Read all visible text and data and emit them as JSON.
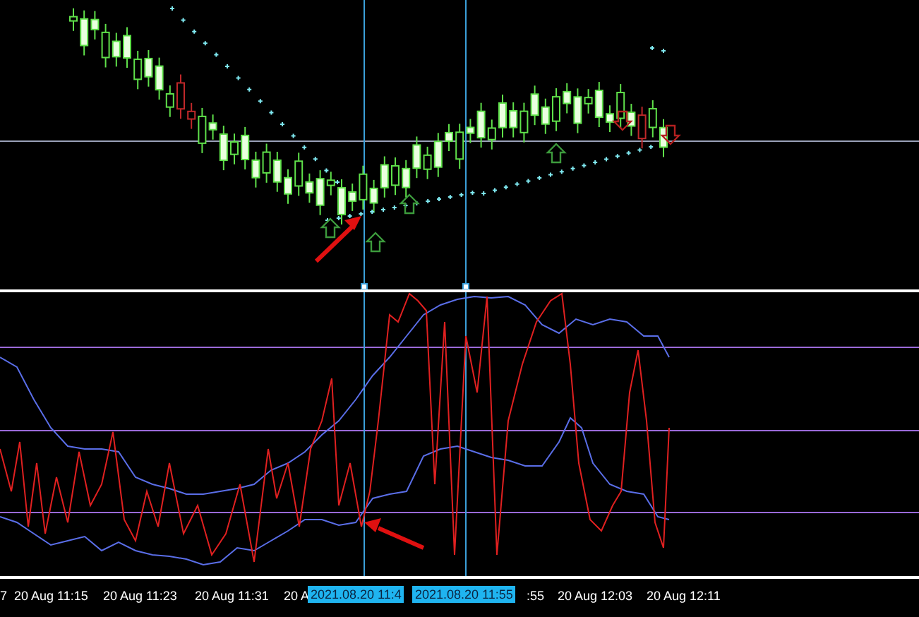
{
  "time_axis": {
    "labels": [
      {
        "text": "7"
      },
      {
        "text": "20 Aug 11:15"
      },
      {
        "text": "20 Aug 11:23"
      },
      {
        "text": "20 Aug 11:31"
      },
      {
        "text": "20 A"
      },
      {
        "text": ":55"
      },
      {
        "text": "20 Aug 12:03"
      },
      {
        "text": "20 Aug 12:11"
      }
    ],
    "crosshair_tags": [
      {
        "text": "2021.08.20 11:4"
      },
      {
        "text": "2021.08.20 11:55"
      }
    ]
  }
}
